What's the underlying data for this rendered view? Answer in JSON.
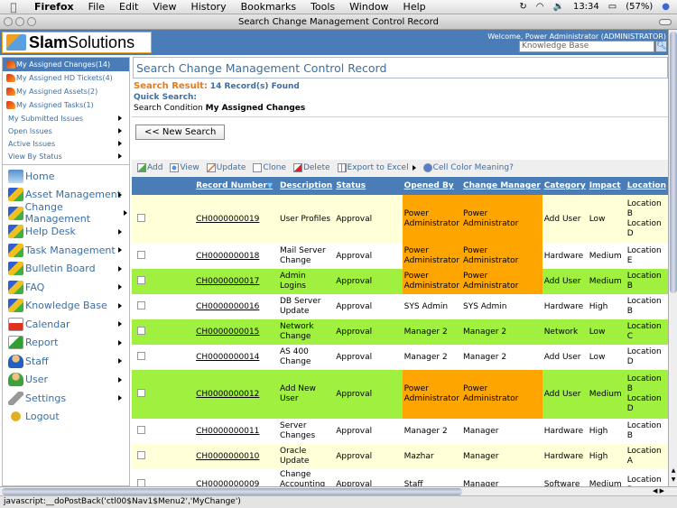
{
  "os_menubar": {
    "app": "Firefox",
    "menus": [
      "File",
      "Edit",
      "View",
      "History",
      "Bookmarks",
      "Tools",
      "Window",
      "Help"
    ],
    "clock": "13:34",
    "battery": "(57%)"
  },
  "window": {
    "title": "Search Change Management Control Record"
  },
  "header": {
    "logo_bold": "Slam",
    "logo_normal": "Solutions",
    "welcome": "Welcome, Power Administrator (ADMINISTRATOR)",
    "kb_search_value": "Knowledge Base"
  },
  "sidebar": {
    "quick_items": [
      {
        "label": "My Assigned Changes(14)",
        "selected": true
      },
      {
        "label": "My Assigned HD Tickets(4)"
      },
      {
        "label": "My Assigned Assets(2)"
      },
      {
        "label": "My Assigned Tasks(1)"
      }
    ],
    "sub_items": [
      {
        "label": "My Submitted Issues"
      },
      {
        "label": "Open Issues"
      },
      {
        "label": "Active Issues"
      },
      {
        "label": "View By Status"
      }
    ],
    "main_items": [
      {
        "label": "Home",
        "icon": "home-icon"
      },
      {
        "label": "Asset Management",
        "icon": "cubes-icon"
      },
      {
        "label": "Change Management",
        "icon": "cubes-icon"
      },
      {
        "label": "Help Desk",
        "icon": "cubes-icon"
      },
      {
        "label": "Task Management",
        "icon": "cubes-icon"
      },
      {
        "label": "Bulletin Board",
        "icon": "cubes-icon"
      },
      {
        "label": "FAQ",
        "icon": "cubes-icon"
      },
      {
        "label": "Knowledge Base",
        "icon": "cubes-icon"
      },
      {
        "label": "Calendar",
        "icon": "calendar-icon"
      },
      {
        "label": "Report",
        "icon": "report-icon"
      },
      {
        "label": "Staff",
        "icon": "staff-icon"
      },
      {
        "label": "User",
        "icon": "user-icon"
      },
      {
        "label": "Settings",
        "icon": "wrench-icon"
      },
      {
        "label": "Logout",
        "icon": "footprints-icon"
      }
    ]
  },
  "main": {
    "page_title": "Search Change Management Control Record",
    "search_result_label": "Search Result:",
    "search_result_count": "14 Record(s) Found",
    "quick_search_label": "Quick Search:",
    "search_condition_label": "Search Condition",
    "search_condition_value": "My Assigned Changes",
    "new_search_button": "<< New Search",
    "toolbar": {
      "add": "Add",
      "view": "View",
      "update": "Update",
      "clone": "Clone",
      "delete": "Delete",
      "export": "Export to Excel",
      "color_meaning": "Cell Color Meaning?"
    },
    "table": {
      "headers": [
        "Record Number",
        "Description",
        "Status",
        "Opened By",
        "Change Manager",
        "Category",
        "Impact",
        "Location"
      ],
      "rows": [
        {
          "record": "CH0000000019",
          "description": "User Profiles",
          "status": "Approval",
          "opened_by": "Power Administrator",
          "manager": "Power Administrator",
          "category": "Add User",
          "impact": "Low",
          "location": "Location B Location D",
          "row_color": "#ffffd8",
          "person_color": "#ffa500"
        },
        {
          "record": "CH0000000018",
          "description": "Mail Server Change",
          "status": "Approval",
          "opened_by": "Power Administrator",
          "manager": "Power Administrator",
          "category": "Hardware",
          "impact": "Medium",
          "location": "Location E",
          "row_color": "#ffffff",
          "person_color": "#ffa500"
        },
        {
          "record": "CH0000000017",
          "description": "Admin Logins",
          "status": "Approval",
          "opened_by": "Power Administrator",
          "manager": "Power Administrator",
          "category": "Add User",
          "impact": "Medium",
          "location": "Location B",
          "row_color": "#a0f040",
          "person_color": "#ffa500"
        },
        {
          "record": "CH0000000016",
          "description": "DB Server Update",
          "status": "Approval",
          "opened_by": "SYS Admin",
          "manager": "SYS Admin",
          "category": "Hardware",
          "impact": "High",
          "location": "Location B",
          "row_color": "#ffffff",
          "person_color": ""
        },
        {
          "record": "CH0000000015",
          "description": "Network Change",
          "status": "Approval",
          "opened_by": "Manager 2",
          "manager": "Manager 2",
          "category": "Network",
          "impact": "Low",
          "location": "Location C",
          "row_color": "#a0f040",
          "person_color": ""
        },
        {
          "record": "CH0000000014",
          "description": "AS 400 Change",
          "status": "Approval",
          "opened_by": "Manager 2",
          "manager": "Manager 2",
          "category": "Add User",
          "impact": "Low",
          "location": "Location D",
          "row_color": "#ffffff",
          "person_color": ""
        },
        {
          "record": "CH0000000012",
          "description": "Add New User",
          "status": "Approval",
          "opened_by": "Power Administrator",
          "manager": "Power Administrator",
          "category": "Add User",
          "impact": "Medium",
          "location": "Location B Location D",
          "row_color": "#a0f040",
          "person_color": "#ffa500"
        },
        {
          "record": "CH0000000011",
          "description": "Server Changes",
          "status": "Approval",
          "opened_by": "Manager 2",
          "manager": "Manager",
          "category": "Hardware",
          "impact": "High",
          "location": "Location B",
          "row_color": "#ffffff",
          "person_color": ""
        },
        {
          "record": "CH0000000010",
          "description": "Oracle Update",
          "status": "Approval",
          "opened_by": "Mazhar",
          "manager": "Manager",
          "category": "Hardware",
          "impact": "High",
          "location": "Location A",
          "row_color": "#ffffd8",
          "person_color": ""
        },
        {
          "record": "CH0000000009",
          "description": "Change Accounting Sofware",
          "status": "Approval",
          "opened_by": "Staff",
          "manager": "Manager",
          "category": "Software",
          "impact": "Medium",
          "location": "Location B",
          "row_color": "#ffffff",
          "person_color": ""
        }
      ]
    }
  },
  "statusbar": {
    "text": "javascript:__doPostBack('ctl00$Nav1$Menu2','MyChange')"
  },
  "colors": {
    "brand_blue": "#4a7db8",
    "orange": "#ffa500",
    "green": "#a0f040",
    "yellow": "#ffffd8",
    "result_orange": "#f07810"
  }
}
